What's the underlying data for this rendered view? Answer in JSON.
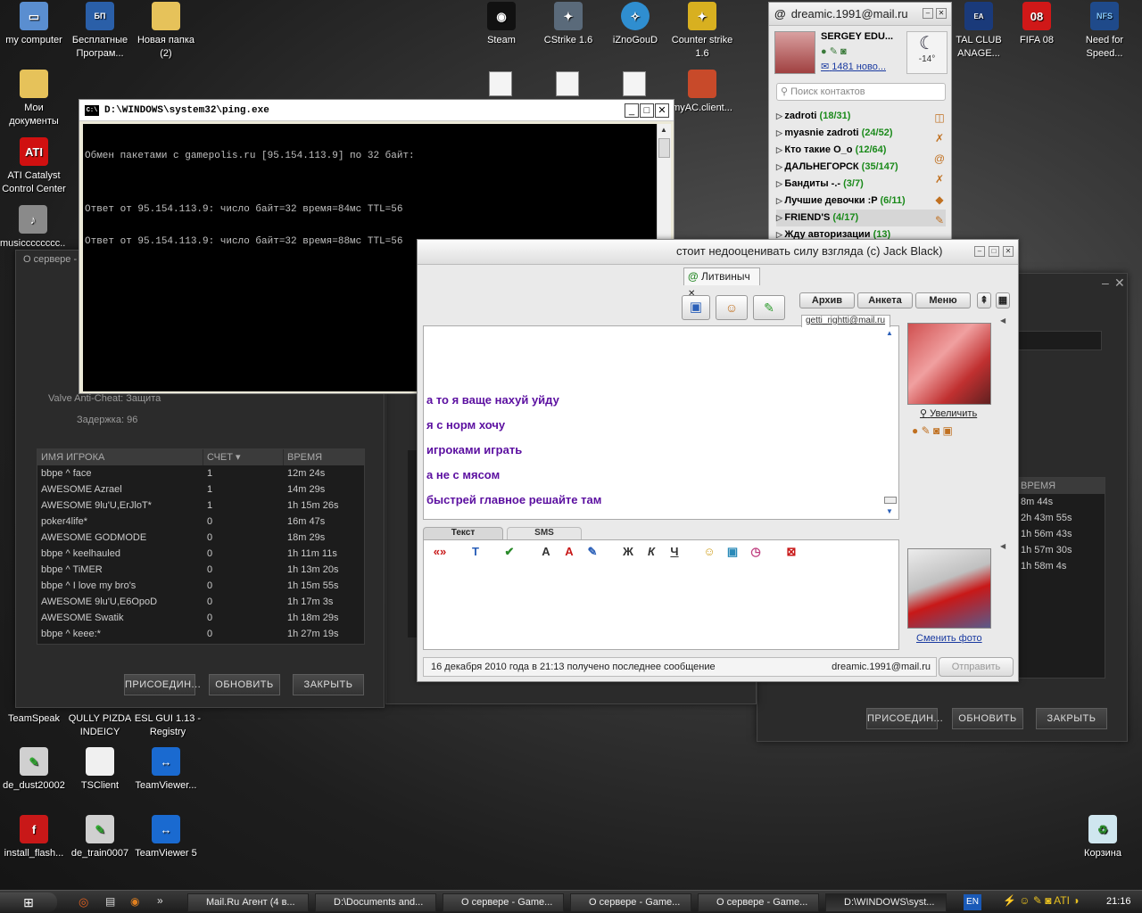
{
  "desktop_icons": [
    {
      "label": "my computer",
      "icon": "computer-icon"
    },
    {
      "label": "Бесплатные Програм...",
      "icon": "program-icon"
    },
    {
      "label": "Новая папка (2)",
      "icon": "folder-icon"
    },
    {
      "label": "Мои документы",
      "icon": "documents-icon"
    },
    {
      "label": "ATI Catalyst Control Center",
      "icon": "ati-icon"
    },
    {
      "label": "musicccccccc...",
      "icon": "music-icon"
    },
    {
      "label": "Steam",
      "icon": "steam-icon"
    },
    {
      "label": "CStrike 1.6",
      "icon": "cstrike-icon"
    },
    {
      "label": "iZnoGouD",
      "icon": "iznogoud-icon"
    },
    {
      "label": "Counter strike 1.6",
      "icon": "counter-strike-icon"
    },
    {
      "label": "myAC.client...",
      "icon": "file-icon"
    },
    {
      "label": "TAL CLUB ANAGE...",
      "icon": "totalclub-icon"
    },
    {
      "label": "FIFA 08",
      "icon": "fifa-icon"
    },
    {
      "label": "Need for Speed...",
      "icon": "nfs-icon"
    },
    {
      "label": "TeamSpeak",
      "icon": "teamspeak-icon"
    },
    {
      "label": "QULLY PIZDA INDEICY",
      "icon": "file-icon"
    },
    {
      "label": "ESL GUI 1.13 - Registry",
      "icon": "file-icon"
    },
    {
      "label": "de_dust20002",
      "icon": "map-icon"
    },
    {
      "label": "TSClient",
      "icon": "tsclient-icon"
    },
    {
      "label": "TeamViewer...",
      "icon": "teamviewer-icon"
    },
    {
      "label": "install_flash...",
      "icon": "flash-icon"
    },
    {
      "label": "de_train0007",
      "icon": "map-icon"
    },
    {
      "label": "TeamViewer 5",
      "icon": "teamviewer-icon"
    },
    {
      "label": "Корзина",
      "icon": "recycle-bin-icon"
    }
  ],
  "server_window_left": {
    "title": "О сервере -",
    "vac_label": "Valve Anti-Cheat:",
    "vac_value": "Защита",
    "latency_label": "Задержка:",
    "latency_value": "96",
    "columns": [
      "ИМЯ ИГРОКА",
      "СЧЕТ",
      "ВРЕМЯ"
    ],
    "players": [
      {
        "name": "bbpe ^ face",
        "score": "1",
        "time": "12m 24s"
      },
      {
        "name": "AWESOME Azrael",
        "score": "1",
        "time": "14m 29s"
      },
      {
        "name": "AWESOME 9lu'U,ErJloT*",
        "score": "1",
        "time": "1h 15m 26s"
      },
      {
        "name": "poker4life*",
        "score": "0",
        "time": "16m 47s"
      },
      {
        "name": "AWESOME GODMODE",
        "score": "0",
        "time": "18m 29s"
      },
      {
        "name": "bbpe ^ keelhauled",
        "score": "0",
        "time": "1h 11m 11s"
      },
      {
        "name": "bbpe ^ TiMER",
        "score": "0",
        "time": "1h 13m 20s"
      },
      {
        "name": "bbpe ^ I love my bro's",
        "score": "0",
        "time": "1h 15m 55s"
      },
      {
        "name": "AWESOME 9lu'U,E6OpoD",
        "score": "0",
        "time": "1h 17m 3s"
      },
      {
        "name": "AWESOME Swatik",
        "score": "0",
        "time": "1h 18m 29s"
      },
      {
        "name": "bbpe ^ keee:*",
        "score": "0",
        "time": "1h 27m 19s"
      }
    ],
    "buttons": [
      "ПРИСОЕДИН...",
      "ОБНОВИТЬ",
      "ЗАКРЫТЬ"
    ]
  },
  "server_window_right": {
    "column": "ВРЕМЯ",
    "times": [
      "8m 44s",
      "2h 43m 55s",
      "1h 56m 43s",
      "1h 57m 30s",
      "1h 58m 4s"
    ],
    "buttons": [
      "ПРИСОЕДИН...",
      "ОБНОВИТЬ",
      "ЗАКРЫТЬ"
    ]
  },
  "ping_window": {
    "title": "D:\\WINDOWS\\system32\\ping.exe",
    "lines": [
      "Обмен пакетами с gamepolis.ru [95.154.113.9] по 32 байт:",
      "",
      "Ответ от 95.154.113.9: число байт=32 время=84мс TTL=56",
      "Ответ от 95.154.113.9: число байт=32 время=88мс TTL=56"
    ]
  },
  "agent": {
    "account": "dreamic.1991@mail.ru",
    "user_name": "SERGEY EDU...",
    "new_mail": "1481 ново...",
    "weather": "-14°",
    "search_placeholder": "Поиск контактов",
    "groups": [
      {
        "name": "zadroti",
        "count": "(18/31)"
      },
      {
        "name": "myasnie zadroti",
        "count": "(24/52)"
      },
      {
        "name": "Кто такие О_о",
        "count": "(12/64)"
      },
      {
        "name": "ДАЛЬНЕГОРСК",
        "count": "(35/147)"
      },
      {
        "name": "Бандиты -.-",
        "count": "(3/7)"
      },
      {
        "name": "Лучшие девочки :P",
        "count": "(6/11)"
      },
      {
        "name": "FRIEND'S",
        "count": "(4/17)"
      },
      {
        "name": "Жду авторизации",
        "count": "(13)"
      }
    ]
  },
  "chat": {
    "title": "стоит недооценивать силу взгляда (с) Jack Black)",
    "tab": "Литвиныч",
    "buttons": {
      "archive": "Архив",
      "profile": "Анкета",
      "menu": "Меню"
    },
    "contact_email": "getti_rightti@mail.ru",
    "zoom_link": "Увеличить",
    "messages": [
      "а то я ваще нахуй уйду",
      "я с норм хочу",
      "игроками играть",
      "а не с мясом",
      "быстрей главное решайте там"
    ],
    "input_tabs": [
      "Текст",
      "SMS"
    ],
    "change_photo": "Сменить фото",
    "status": "16 декабря 2010 года в 21:13 получено последнее сообщение",
    "sender": "dreamic.1991@mail.ru",
    "send_button": "Отправить"
  },
  "taskbar": {
    "tasks": [
      "Mail.Ru Агент (4 в...",
      "D:\\Documents and...",
      "О сервере - Game...",
      "О сервере - Game...",
      "О сервере - Game...",
      "D:\\WINDOWS\\syst..."
    ],
    "language": "EN",
    "clock": "21:16"
  }
}
